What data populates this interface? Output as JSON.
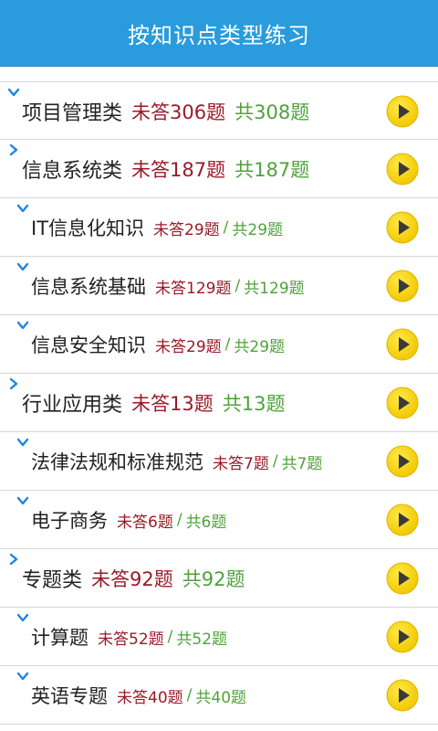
{
  "header": {
    "title": "按知识点类型练习"
  },
  "items": [
    {
      "level": 1,
      "expanded": true,
      "title": "项目管理类",
      "unanswered": "未答306题",
      "total": "共308题"
    },
    {
      "level": 1,
      "expanded": false,
      "title": "信息系统类",
      "unanswered": "未答187题",
      "total": "共187题"
    },
    {
      "level": 2,
      "expanded": true,
      "title": "IT信息化知识",
      "unanswered": "未答29题",
      "sep": "/",
      "total": "共29题"
    },
    {
      "level": 2,
      "expanded": true,
      "title": "信息系统基础",
      "unanswered": "未答129题",
      "sep": "/",
      "total": "共129题"
    },
    {
      "level": 2,
      "expanded": true,
      "title": "信息安全知识",
      "unanswered": "未答29题",
      "sep": "/",
      "total": "共29题"
    },
    {
      "level": 1,
      "expanded": false,
      "title": "行业应用类",
      "unanswered": "未答13题",
      "total": "共13题"
    },
    {
      "level": 2,
      "expanded": true,
      "title": "法律法规和标准规范",
      "unanswered": "未答7题",
      "sep": "/",
      "total": "共7题"
    },
    {
      "level": 2,
      "expanded": true,
      "title": "电子商务",
      "unanswered": "未答6题",
      "sep": "/",
      "total": "共6题"
    },
    {
      "level": 1,
      "expanded": false,
      "title": "专题类",
      "unanswered": "未答92题",
      "total": "共92题"
    },
    {
      "level": 2,
      "expanded": true,
      "title": "计算题",
      "unanswered": "未答52题",
      "sep": "/",
      "total": "共52题"
    },
    {
      "level": 2,
      "expanded": true,
      "title": "英语专题",
      "unanswered": "未答40题",
      "sep": "/",
      "total": "共40题"
    }
  ],
  "icons": {
    "expand": "chevron-down-icon",
    "collapse": "chevron-right-icon",
    "play": "play-icon"
  },
  "colors": {
    "header_bg": "#2a9bdc",
    "unanswered": "#9a1a28",
    "total": "#4fa23b",
    "chevron": "#1e84e8",
    "play_fill": "#f5d000"
  }
}
